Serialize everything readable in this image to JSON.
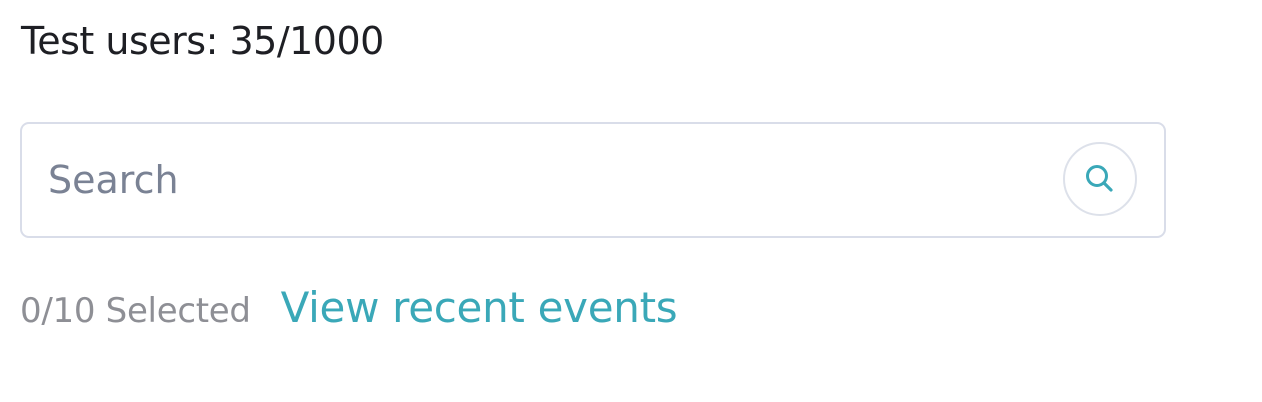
{
  "header": {
    "title": "Test users: 35/1000"
  },
  "search": {
    "placeholder": "Search",
    "value": "",
    "button_icon": "search-icon"
  },
  "selection": {
    "count_text": "0/10 Selected"
  },
  "links": {
    "view_recent_events": "View recent events"
  },
  "colors": {
    "accent": "#3aa8b8",
    "title_text": "#1e1f24",
    "muted_text": "#8e8f95",
    "border": "#d9dde9"
  }
}
